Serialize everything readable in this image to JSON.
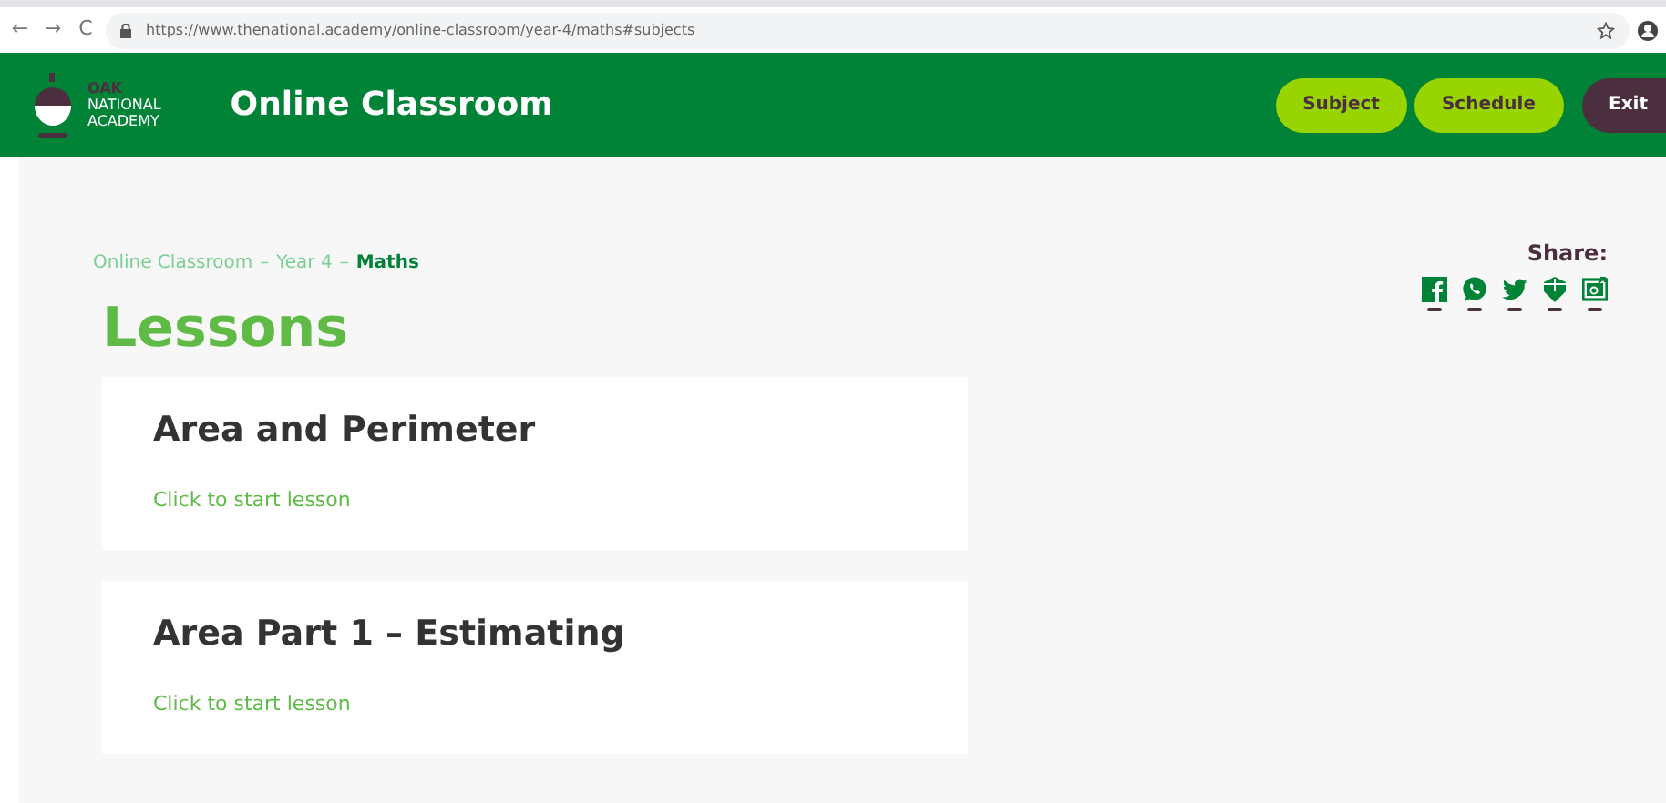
{
  "browser": {
    "nav_buttons": [
      "←",
      "→",
      "C"
    ],
    "url": "https://www.thenational.academy/online-classroom/year-4/maths#subjects"
  },
  "header": {
    "logo_lines": [
      "OAK",
      "NATIONAL",
      "ACADEMY"
    ],
    "title": "Online Classroom",
    "buttons": [
      {
        "label": "Subject",
        "kind": "primary"
      },
      {
        "label": "Schedule",
        "kind": "primary"
      },
      {
        "label": "Exit",
        "kind": "dark"
      }
    ]
  },
  "breadcrumb": [
    {
      "label": "Online Classroom",
      "current": false
    },
    {
      "label": "Year 4",
      "current": false
    },
    {
      "label": "Maths",
      "current": true
    }
  ],
  "breadcrumb_separator": "–",
  "share": {
    "label": "Share:"
  },
  "heading": "Lessons",
  "lessons": [
    {
      "title": "Area and Perimeter",
      "link": "Click to start lesson"
    },
    {
      "title": "Area Part 1 – Estimating",
      "link": "Click to start lesson"
    }
  ]
}
